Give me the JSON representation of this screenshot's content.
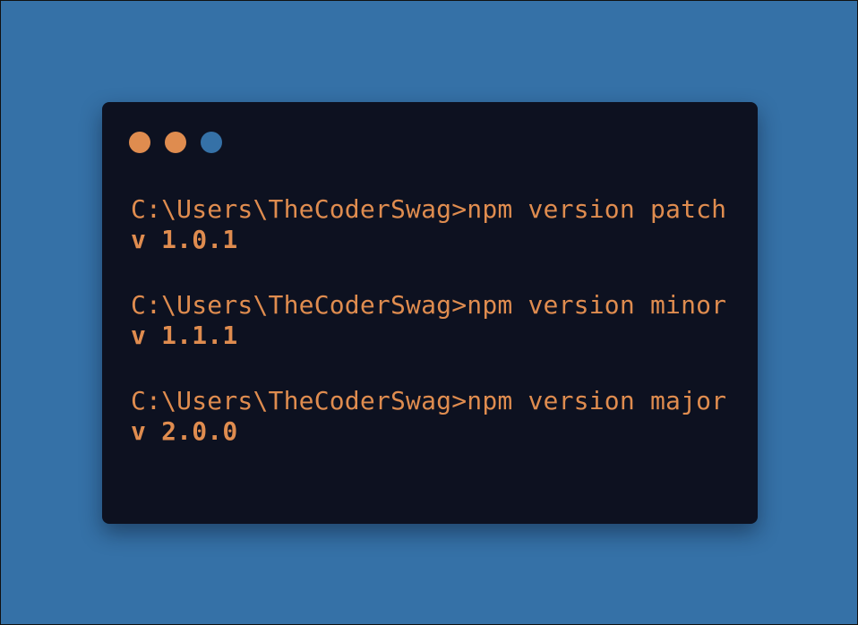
{
  "theme": {
    "background_color": "#3571a7",
    "terminal_background": "#0d1120",
    "prompt_color": "#df8c4f",
    "window_controls": [
      {
        "name": "orange-dot",
        "color": "#df8c4f"
      },
      {
        "name": "orange-dot",
        "color": "#df8c4f"
      },
      {
        "name": "blue-dot",
        "color": "#3571a7"
      }
    ]
  },
  "terminal": {
    "entries": [
      {
        "command": "C:\\Users\\TheCoderSwag>npm version patch",
        "output": "v 1.0.1"
      },
      {
        "command": "C:\\Users\\TheCoderSwag>npm version minor",
        "output": "v 1.1.1"
      },
      {
        "command": "C:\\Users\\TheCoderSwag>npm version major",
        "output": "v 2.0.0"
      }
    ]
  }
}
